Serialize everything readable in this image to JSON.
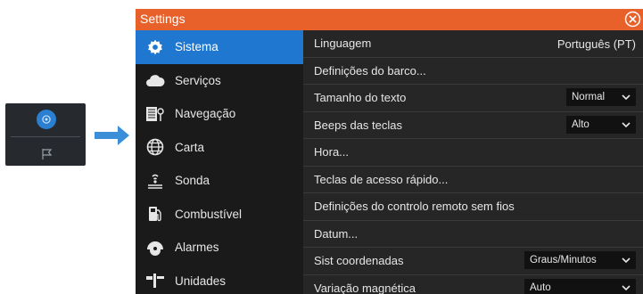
{
  "dialog": {
    "title": "Settings"
  },
  "sidebar": {
    "items": [
      {
        "label": "Sistema",
        "icon": "gear-icon",
        "active": true
      },
      {
        "label": "Serviços",
        "icon": "cloud-icon"
      },
      {
        "label": "Navegação",
        "icon": "navigation-icon"
      },
      {
        "label": "Carta",
        "icon": "globe-icon"
      },
      {
        "label": "Sonda",
        "icon": "sonar-icon"
      },
      {
        "label": "Combustível",
        "icon": "fuel-pump-icon"
      },
      {
        "label": "Alarmes",
        "icon": "alarm-icon"
      },
      {
        "label": "Unidades",
        "icon": "units-icon"
      }
    ]
  },
  "settings": {
    "rows": [
      {
        "label": "Linguagem",
        "value": "Português (PT)"
      },
      {
        "label": "Definições do barco..."
      },
      {
        "label": "Tamanho do texto",
        "select": "Normal"
      },
      {
        "label": "Beeps das teclas",
        "select": "Alto"
      },
      {
        "label": "Hora..."
      },
      {
        "label": "Teclas de acesso rápido..."
      },
      {
        "label": "Definições do controlo remoto sem fios"
      },
      {
        "label": "Datum..."
      },
      {
        "label": "Sist coordenadas",
        "select": "Graus/Minutos"
      },
      {
        "label": "Variação magnética",
        "select": "Auto"
      }
    ]
  },
  "colors": {
    "titlebar": "#e8612a",
    "active": "#1f77d0",
    "arrow": "#3a8fd8"
  }
}
